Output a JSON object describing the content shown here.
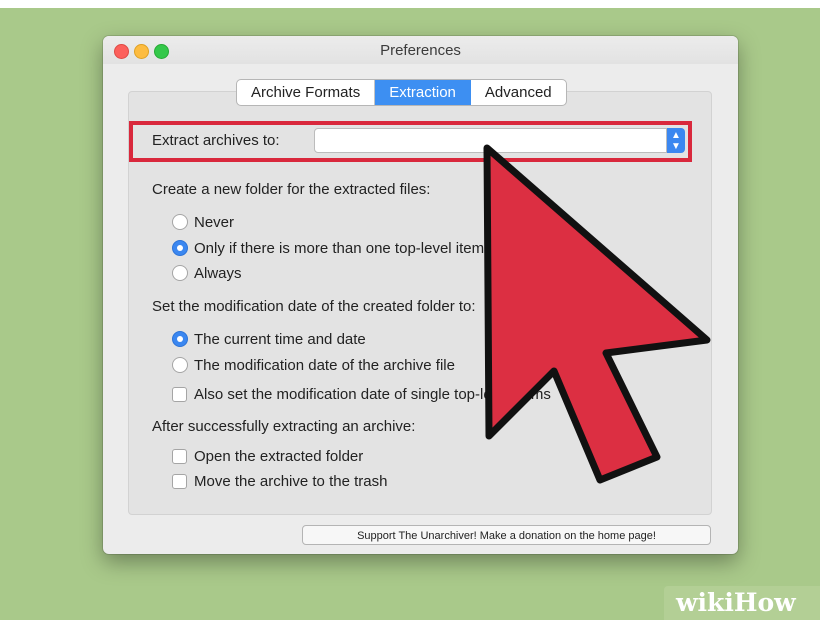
{
  "window": {
    "title": "Preferences"
  },
  "tabs": [
    {
      "label": "Archive Formats",
      "active": false
    },
    {
      "label": "Extraction",
      "active": true
    },
    {
      "label": "Advanced",
      "active": false
    }
  ],
  "extract": {
    "label": "Extract archives to:",
    "value": ""
  },
  "folder_section": {
    "heading": "Create a new folder for the extracted files:",
    "options": [
      {
        "label": "Never",
        "selected": false
      },
      {
        "label": "Only if there is more than one top-level item",
        "selected": true
      },
      {
        "label": "Always",
        "selected": false
      }
    ]
  },
  "date_section": {
    "heading": "Set the modification date of the created folder to:",
    "options": [
      {
        "label": "The current time and date",
        "selected": true
      },
      {
        "label": "The modification date of the archive file",
        "selected": false
      }
    ],
    "checkbox": {
      "label": "Also set the modification date of single top-level items",
      "checked": false
    }
  },
  "after_section": {
    "heading": "After successfully extracting an archive:",
    "checkboxes": [
      {
        "label": "Open the extracted folder",
        "checked": false
      },
      {
        "label": "Move the archive to the trash",
        "checked": false
      }
    ]
  },
  "support_button": "Support The Unarchiver! Make a donation on the home page!",
  "watermark": "wikiHow",
  "colors": {
    "accent": "#3b87f0",
    "highlight": "#d9283c",
    "background": "#a9c98a"
  }
}
